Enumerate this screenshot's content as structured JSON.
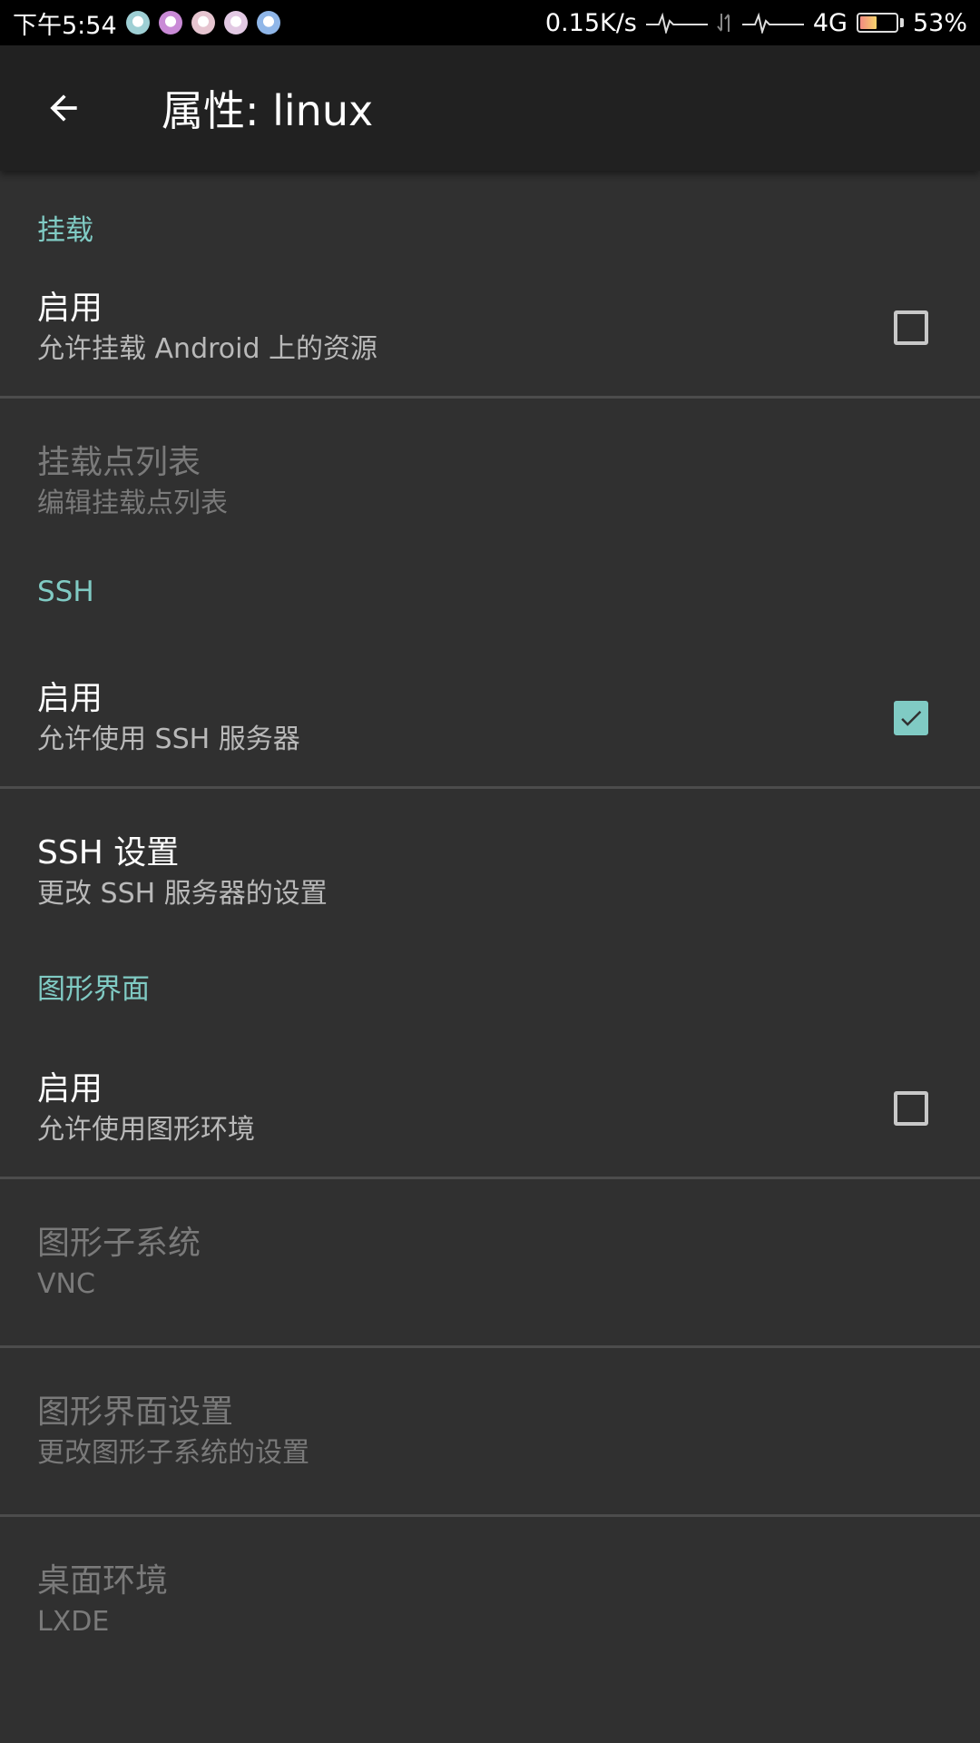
{
  "status_bar": {
    "time": "下午5:54",
    "notification_icons": [
      {
        "icon": "app-notification-icon",
        "color": "#9ecfd4"
      },
      {
        "icon": "app-notification-icon",
        "color": "#c98ad6"
      },
      {
        "icon": "app-notification-icon",
        "color": "#e6c5d0"
      },
      {
        "icon": "app-notification-icon",
        "color": "#e2c9e3"
      },
      {
        "icon": "app-notification-icon",
        "color": "#8fb6e8"
      }
    ],
    "net_speed": "0.15K/s",
    "network_type": "4G",
    "battery_percent": "53%",
    "battery_level": 0.53
  },
  "toolbar": {
    "back_icon": "arrow-back-icon",
    "title": "属性: linux"
  },
  "colors": {
    "accent": "#80cbc4",
    "background": "#303030",
    "toolbar": "#212121"
  },
  "sections": [
    {
      "header": "挂载",
      "items": [
        {
          "title": "启用",
          "summary": "允许挂载 Android 上的资源",
          "checkbox": true,
          "checked": false,
          "enabled": true
        },
        {
          "title": "挂载点列表",
          "summary": "编辑挂载点列表",
          "checkbox": false,
          "enabled": false
        }
      ]
    },
    {
      "header": "SSH",
      "items": [
        {
          "title": "启用",
          "summary": "允许使用 SSH 服务器",
          "checkbox": true,
          "checked": true,
          "enabled": true
        },
        {
          "title": "SSH 设置",
          "summary": "更改 SSH 服务器的设置",
          "checkbox": false,
          "enabled": true
        }
      ]
    },
    {
      "header": "图形界面",
      "items": [
        {
          "title": "启用",
          "summary": "允许使用图形环境",
          "checkbox": true,
          "checked": false,
          "enabled": true
        },
        {
          "title": "图形子系统",
          "summary": "VNC",
          "checkbox": false,
          "enabled": false
        },
        {
          "title": "图形界面设置",
          "summary": "更改图形子系统的设置",
          "checkbox": false,
          "enabled": false
        },
        {
          "title": "桌面环境",
          "summary": "LXDE",
          "checkbox": false,
          "enabled": false
        }
      ]
    }
  ]
}
